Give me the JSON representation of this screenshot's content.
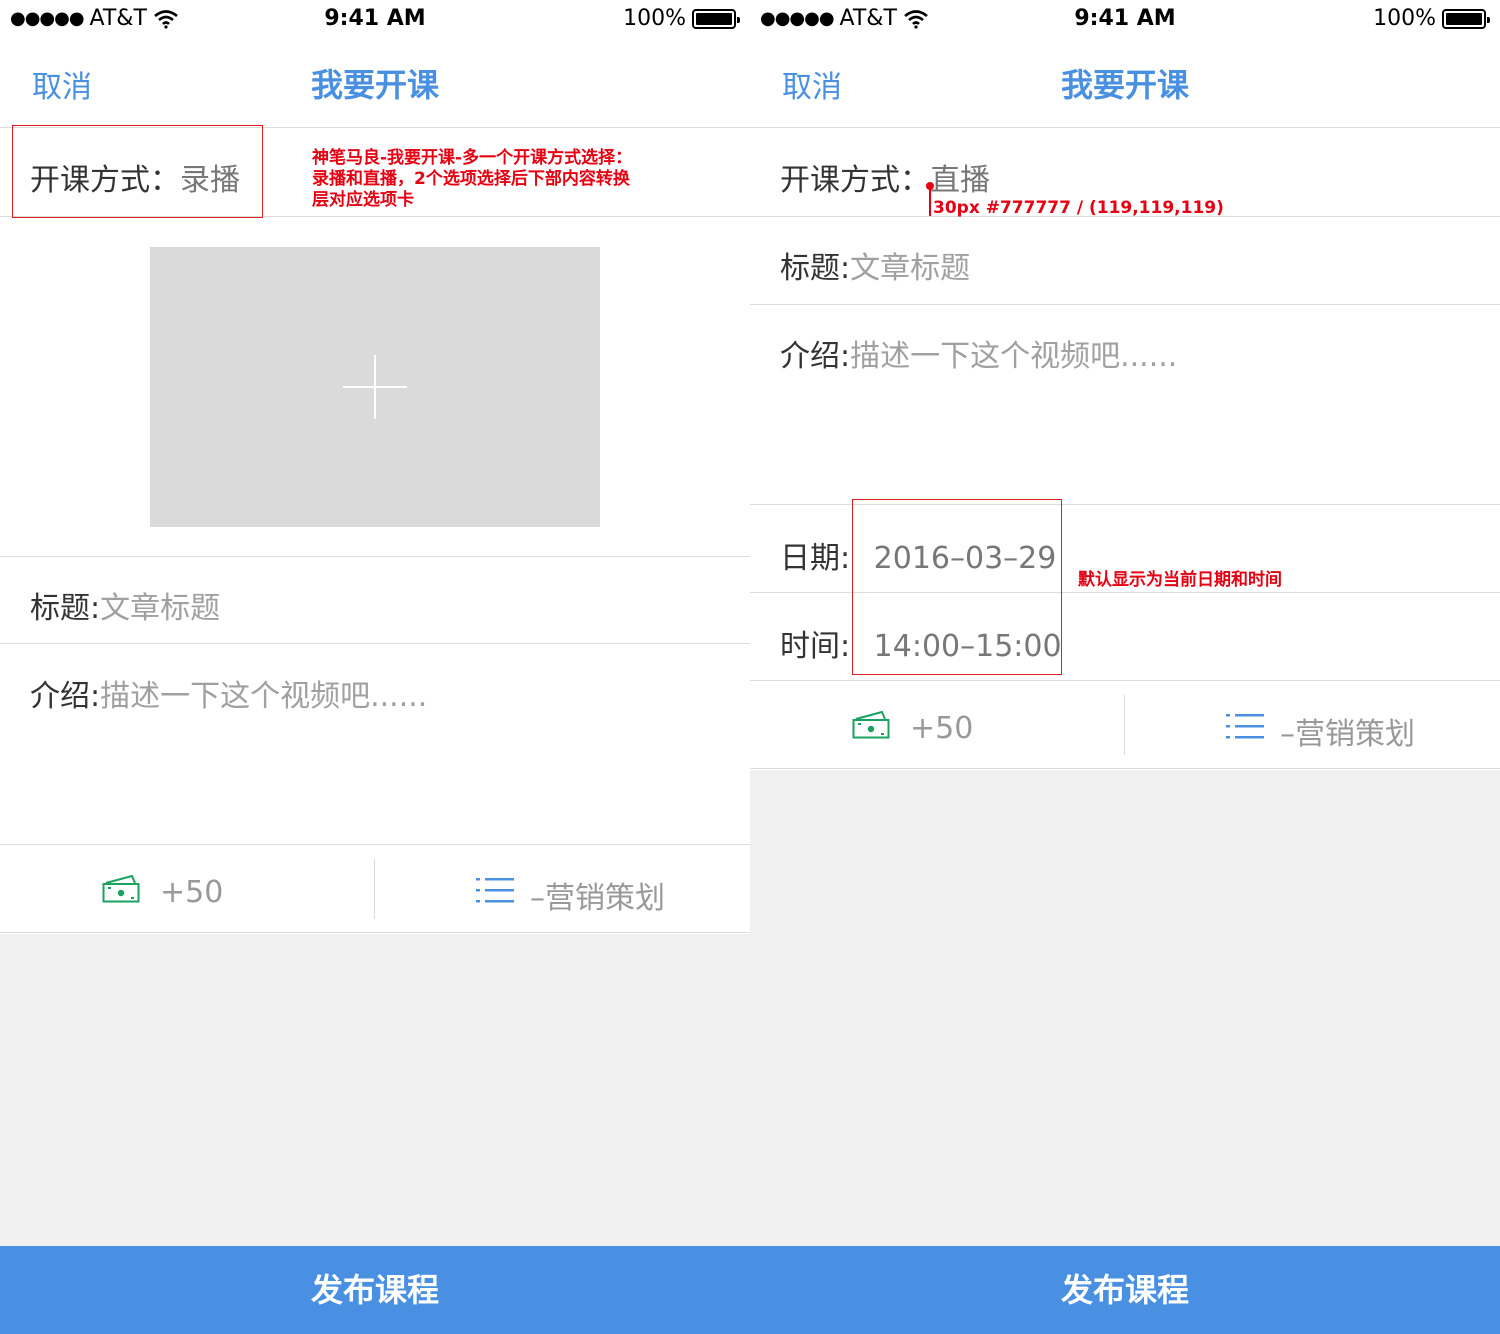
{
  "status_bar": {
    "signal": "●●●●●",
    "carrier": "AT&T",
    "time": "9:41 AM",
    "battery": "100%"
  },
  "nav": {
    "cancel": "取消",
    "title": "我要开课"
  },
  "left": {
    "mode_label": "开课方式：",
    "mode_value": "录播",
    "title_label": "标题:",
    "title_placeholder": "文章标题",
    "intro_label": "介绍:",
    "intro_placeholder": "描述一下这个视频吧......",
    "money": "+50",
    "marketing": "–营销策划",
    "annotation": "神笔马良-我要开课-多一个开课方式选择：录播和直播，2个选项选择后下部内容转换层对应选项卡"
  },
  "right": {
    "mode_label": "开课方式：",
    "mode_value": "直播",
    "title_label": "标题:",
    "title_placeholder": "文章标题",
    "intro_label": "介绍:",
    "intro_placeholder": "描述一下这个视频吧......",
    "date_label": "日期:",
    "date_value": "2016–03–29",
    "time_label": "时间:",
    "time_value": "14:00–15:00",
    "money": "+50",
    "marketing": "–营销策划",
    "annotation_spec": "30px #777777 / (119,119,119)",
    "annotation_default": "默认显示为当前日期和时间"
  },
  "publish_button": "发布课程",
  "colors": {
    "accent": "#4a90e2",
    "annotation": "#e60012",
    "money_icon": "#1aa260",
    "value_text": "#777777",
    "background_gray": "#f0f0f0"
  },
  "icons": {
    "money": "money-icon",
    "list": "list-icon",
    "wifi": "wifi-icon",
    "battery": "battery-icon"
  }
}
